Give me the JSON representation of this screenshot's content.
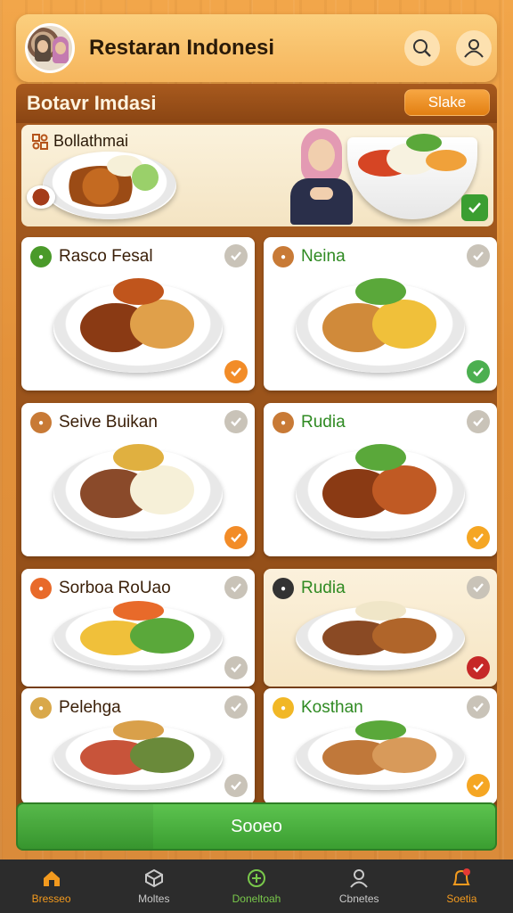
{
  "header": {
    "title": "Restaran Indonesi",
    "search_icon": "search-icon",
    "profile_icon": "user-icon"
  },
  "section": {
    "title": "Botavr Imdasi",
    "filter_label": "Slake"
  },
  "banner": {
    "label": "Bollathmai"
  },
  "cards": [
    {
      "title": "Rasco Fesal",
      "title_color": "#3a1f08",
      "checked": true,
      "check_color": "#f28c28"
    },
    {
      "title": "Neina",
      "title_color": "#2f8a22",
      "checked": true,
      "check_color": "#4caf50"
    },
    {
      "title": "Seive Buikan",
      "title_color": "#3a1f08",
      "checked": true,
      "check_color": "#f28c28"
    },
    {
      "title": "Rudia",
      "title_color": "#2f8a22",
      "checked": true,
      "check_color": "#f5a623"
    },
    {
      "title": "Sorboa RoUao",
      "title_color": "#3a1f08",
      "checked": false,
      "check_color": "#c9c3b8"
    },
    {
      "title": "Rudia",
      "title_color": "#2f8a22",
      "checked": true,
      "check_color": "#c62828"
    },
    {
      "title": "Pelehga",
      "title_color": "#3a1f08",
      "checked": false,
      "check_color": "#c9c3b8"
    },
    {
      "title": "Kosthan",
      "title_color": "#2f8a22",
      "checked": true,
      "check_color": "#f5a623"
    }
  ],
  "cta": {
    "label": "Sooeo"
  },
  "nav": [
    {
      "label": "Bresseo",
      "icon": "home-icon"
    },
    {
      "label": "Moltes",
      "icon": "cube-icon"
    },
    {
      "label": "Doneltoah",
      "icon": "plus-icon"
    },
    {
      "label": "Cbnetes",
      "icon": "user-icon"
    },
    {
      "label": "Soetia",
      "icon": "bell-icon"
    }
  ],
  "colors": {
    "accent": "#f39a1e",
    "green": "#4caf50",
    "brown": "#8a4513"
  }
}
